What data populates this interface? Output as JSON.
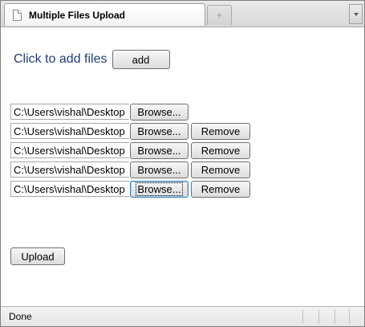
{
  "tab": {
    "title": "Multiple Files Upload"
  },
  "new_tab_glyph": "+",
  "form": {
    "add_label": "Click to add files",
    "add_button": "add",
    "browse_label": "Browse...",
    "remove_label": "Remove",
    "upload_button": "Upload",
    "file_rows": [
      {
        "path": "C:\\Users\\vishal\\Desktop"
      },
      {
        "path": "C:\\Users\\vishal\\Desktop"
      },
      {
        "path": "C:\\Users\\vishal\\Desktop"
      },
      {
        "path": "C:\\Users\\vishal\\Desktop"
      },
      {
        "path": "C:\\Users\\vishal\\Desktop"
      }
    ]
  },
  "status": {
    "text": "Done"
  }
}
